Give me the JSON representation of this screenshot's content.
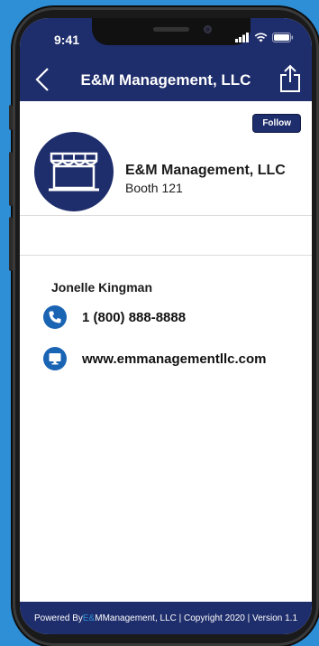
{
  "status": {
    "time": "9:41"
  },
  "header": {
    "title": "E&M Management, LLC"
  },
  "actions": {
    "follow_label": "Follow"
  },
  "exhibitor": {
    "name": "E&M Management, LLC",
    "booth": "Booth 121"
  },
  "contact": {
    "person": "Jonelle Kingman",
    "phone": "1 (800) 888-8888",
    "website": "www.emmanagementllc.com"
  },
  "footer": {
    "prefix": "Powered By ",
    "brand_e": "E&",
    "brand_m": "M",
    "suffix": " Management, LLC | Copyright 2020 | Version 1.1"
  },
  "colors": {
    "primary": "#1e2d6b",
    "accent": "#1a64b4",
    "background": "#2f8fd6"
  },
  "icons": [
    "back-chevron-icon",
    "share-icon",
    "storefront-icon",
    "phone-icon",
    "monitor-icon",
    "signal-icon",
    "wifi-icon",
    "battery-icon"
  ]
}
